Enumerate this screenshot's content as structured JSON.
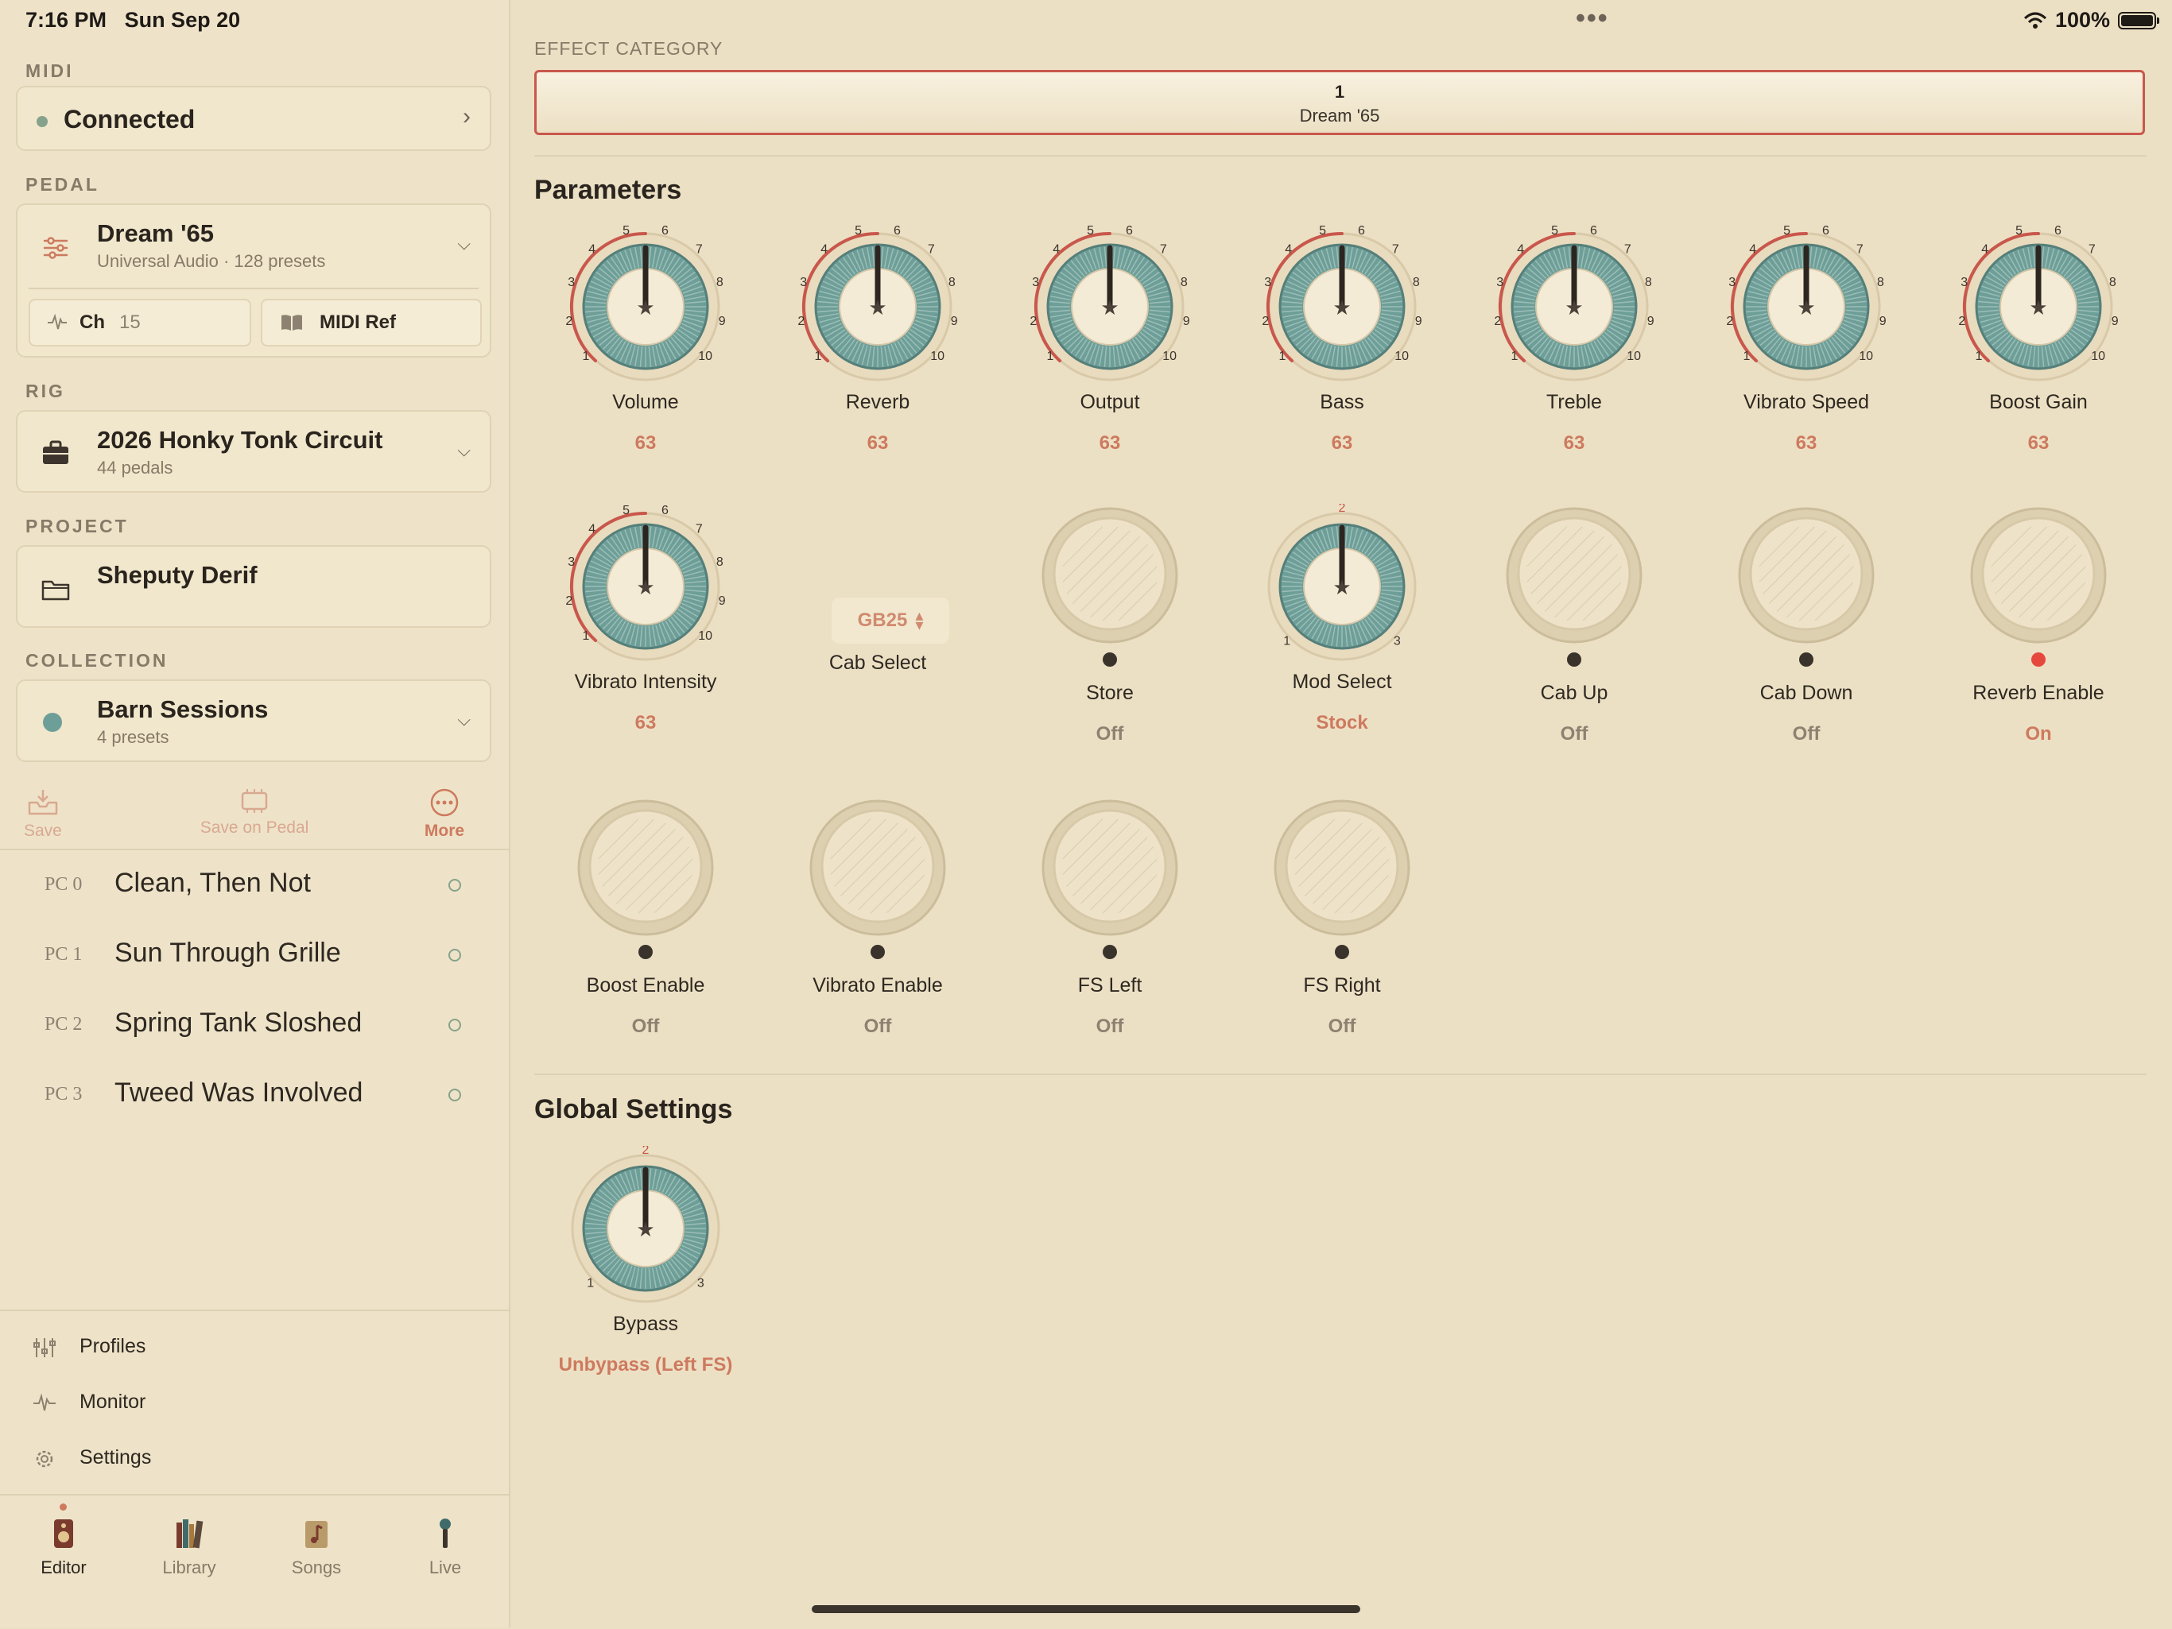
{
  "status": {
    "time": "7:16 PM",
    "date": "Sun Sep 20",
    "battery": "100%"
  },
  "sidebar": {
    "midi": {
      "label": "MIDI",
      "status": "Connected"
    },
    "pedal": {
      "label": "PEDAL",
      "name": "Dream '65",
      "sub": "Universal Audio · 128 presets",
      "ch_label": "Ch",
      "ch_value": "15",
      "midi_ref": "MIDI Ref"
    },
    "rig": {
      "label": "RIG",
      "name": "2026 Honky Tonk Circuit",
      "sub": "44 pedals"
    },
    "project": {
      "label": "PROJECT",
      "name": "Sheputy Derif"
    },
    "collection": {
      "label": "COLLECTION",
      "name": "Barn Sessions",
      "sub": "4 presets"
    },
    "actions": {
      "save": "Save",
      "save_on_pedal": "Save on Pedal",
      "more": "More"
    },
    "presets": [
      {
        "pc": "PC 0",
        "name": "Clean, Then Not"
      },
      {
        "pc": "PC 1",
        "name": "Sun Through Grille"
      },
      {
        "pc": "PC 2",
        "name": "Spring Tank Sloshed"
      },
      {
        "pc": "PC 3",
        "name": "Tweed Was Involved"
      }
    ],
    "links": {
      "profiles": "Profiles",
      "monitor": "Monitor",
      "settings": "Settings"
    },
    "tabs": {
      "editor": "Editor",
      "library": "Library",
      "songs": "Songs",
      "live": "Live"
    }
  },
  "main": {
    "effect_category": {
      "label": "EFFECT CATEGORY",
      "number": "1",
      "name": "Dream '65"
    },
    "parameters_title": "Parameters",
    "parameters": [
      {
        "name": "Volume",
        "value": "63"
      },
      {
        "name": "Reverb",
        "value": "63"
      },
      {
        "name": "Output",
        "value": "63"
      },
      {
        "name": "Bass",
        "value": "63"
      },
      {
        "name": "Treble",
        "value": "63"
      },
      {
        "name": "Vibrato Speed",
        "value": "63"
      },
      {
        "name": "Boost Gain",
        "value": "63"
      },
      {
        "name": "Vibrato Intensity",
        "value": "63"
      },
      {
        "name": "Cab Select",
        "value": "GB25"
      },
      {
        "name": "Store",
        "value": "Off"
      },
      {
        "name": "Mod Select",
        "value": "Stock"
      },
      {
        "name": "Cab Up",
        "value": "Off"
      },
      {
        "name": "Cab Down",
        "value": "Off"
      },
      {
        "name": "Reverb Enable",
        "value": "On"
      },
      {
        "name": "Boost Enable",
        "value": "Off"
      },
      {
        "name": "Vibrato Enable",
        "value": "Off"
      },
      {
        "name": "FS Left",
        "value": "Off"
      },
      {
        "name": "FS Right",
        "value": "Off"
      }
    ],
    "global_title": "Global Settings",
    "bypass": {
      "name": "Bypass",
      "value": "Unbypass (Left FS)"
    },
    "knob_scale_10": [
      "1",
      "2",
      "3",
      "4",
      "5",
      "6",
      "7",
      "8",
      "9",
      "10"
    ],
    "knob_scale_3": [
      "1",
      "2",
      "3"
    ]
  },
  "colors": {
    "accent": "#c9574c",
    "teal": "#6e9e98",
    "value": "#cd7a5f",
    "background": "#ece0c4"
  }
}
